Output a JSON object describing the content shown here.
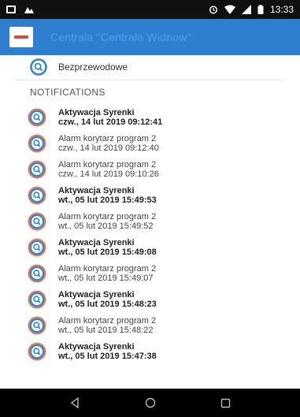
{
  "status_bar": {
    "time": "13:33",
    "left_icons": [
      "image-icon",
      "notification-icon"
    ],
    "right_icons": [
      "alarm-icon",
      "wifi-icon",
      "signal-icon",
      "battery-icon"
    ]
  },
  "app_bar": {
    "title": "Centrala \"Centrala Widnow\"",
    "logo": "app-logo-icon",
    "color": "#2f7fd1"
  },
  "wireless": {
    "label": "Bezprzewodowe",
    "icon": "search-badge-icon"
  },
  "notifications": {
    "header": "NOTIFICATIONS",
    "items": [
      {
        "title": "Aktywacja Syrenki",
        "date": "czw., 14 lut 2019 09:12:41",
        "style": "bold"
      },
      {
        "title": "Alarm korytarz program 2",
        "date": "czw., 14 lut 2019 09:12:40",
        "style": "regular"
      },
      {
        "title": "Alarm korytarz program 2",
        "date": "czw., 14 lut 2019 09:10:26",
        "style": "regular"
      },
      {
        "title": "Aktywacja Syrenki",
        "date": "wt., 05 lut 2019 15:49:53",
        "style": "bold"
      },
      {
        "title": "Alarm korytarz program 2",
        "date": "wt., 05 lut 2019 15:49:52",
        "style": "regular"
      },
      {
        "title": "Aktywacja Syrenki",
        "date": "wt., 05 lut 2019 15:49:08",
        "style": "bold"
      },
      {
        "title": "Alarm korytarz program 2",
        "date": "wt., 05 lut 2019 15:49:07",
        "style": "regular"
      },
      {
        "title": "Aktywacja Syrenki",
        "date": "wt., 05 lut 2019 15:48:23",
        "style": "bold"
      },
      {
        "title": "Alarm korytarz program 2",
        "date": "wt., 05 lut 2019 15:48:22",
        "style": "regular"
      },
      {
        "title": "Aktywacja Syrenki",
        "date": "wt., 05 lut 2019 15:47:38",
        "style": "bold"
      }
    ]
  },
  "nav_bar": {
    "buttons": [
      "back-icon",
      "home-icon",
      "recents-icon"
    ]
  },
  "colors": {
    "icon_ring": "#ee7a4f",
    "icon_inner": "#2f86d6",
    "app_bar": "#2f7fd1",
    "status_bar": "#101010"
  }
}
